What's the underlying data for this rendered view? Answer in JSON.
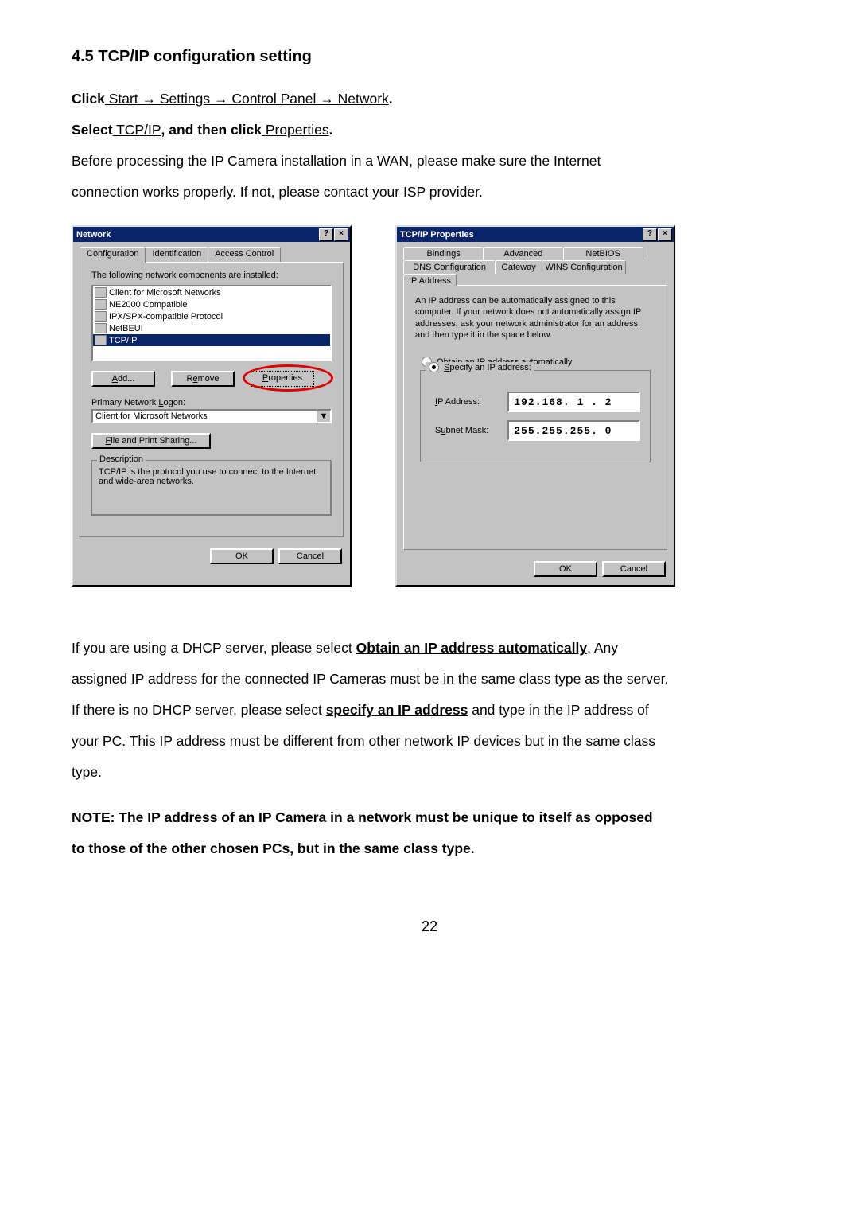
{
  "heading": "4.5 TCP/IP configuration setting",
  "line1_prefix": "Click",
  "line1_path": " Start → Settings → Control Panel → Network",
  "line1_suffix": ".",
  "line2_a": "Select",
  "line2_b": " TCP/IP",
  "line2_c": ", and then click",
  "line2_d": " Properties",
  "line2_e": ".",
  "para1_a": "Before processing the IP Camera installation in a WAN, please make sure the Internet",
  "para1_b": "connection works properly. If not, please contact your ISP provider.",
  "network_dialog": {
    "title": "Network",
    "help": "?",
    "close": "×",
    "tabs": {
      "configuration": "Configuration",
      "identification": "Identification",
      "access": "Access Control"
    },
    "components_label_a": "The following ",
    "components_label_u": "n",
    "components_label_b": "etwork components are installed:",
    "items": [
      "Client for Microsoft Networks",
      "NE2000 Compatible",
      "IPX/SPX-compatible Protocol",
      "NetBEUI",
      "TCP/IP"
    ],
    "add": "Add...",
    "remove": "Remove",
    "properties": "Properties",
    "primary_a": "Primary Network ",
    "primary_u": "L",
    "primary_b": "ogon:",
    "primary_value": "Client for Microsoft Networks",
    "file_print": "File and Print Sharing...",
    "description_title": "Description",
    "description_text": "TCP/IP is the protocol you use to connect to the Internet and wide-area networks.",
    "ok": "OK",
    "cancel": "Cancel"
  },
  "tcpip_dialog": {
    "title": "TCP/IP Properties",
    "help": "?",
    "close": "×",
    "tabs": {
      "bindings": "Bindings",
      "advanced": "Advanced",
      "netbios": "NetBIOS",
      "dns": "DNS Configuration",
      "gateway": "Gateway",
      "wins": "WINS Configuration",
      "ip": "IP Address"
    },
    "explain": "An IP address can be automatically assigned to this computer. If your network does not automatically assign IP addresses, ask your network administrator for an address, and then type it in the space below.",
    "obtain_u": "O",
    "obtain_rest": "btain an IP address automatically",
    "specify_u": "S",
    "specify_rest": "pecify an IP address:",
    "ip_label_u": "I",
    "ip_label_rest": "P Address:",
    "ip_value": "192.168. 1 . 2",
    "subnet_a": "S",
    "subnet_u": "u",
    "subnet_b": "bnet Mask:",
    "subnet_value": "255.255.255. 0",
    "ok": "OK",
    "cancel": "Cancel"
  },
  "para2_a": "If you are using a DHCP server, please select ",
  "para2_b": "Obtain an IP address automatically",
  "para2_c": ". Any",
  "para3": "assigned IP address for the connected  IP Cameras must be in the same class type as the server.",
  "para4_a": "If there is no DHCP server, please select ",
  "para4_b": "specify an IP address",
  "para4_c": " and type in the IP address of",
  "para5": "your PC. This IP address must be different from other network IP devices but in the same class",
  "para6": "type.",
  "note_a": "NOTE: The IP address of an IP Camera in a network must be unique to itself as opposed",
  "note_b": "to those of the other chosen PCs, but in the same class type.",
  "page_number": "22"
}
